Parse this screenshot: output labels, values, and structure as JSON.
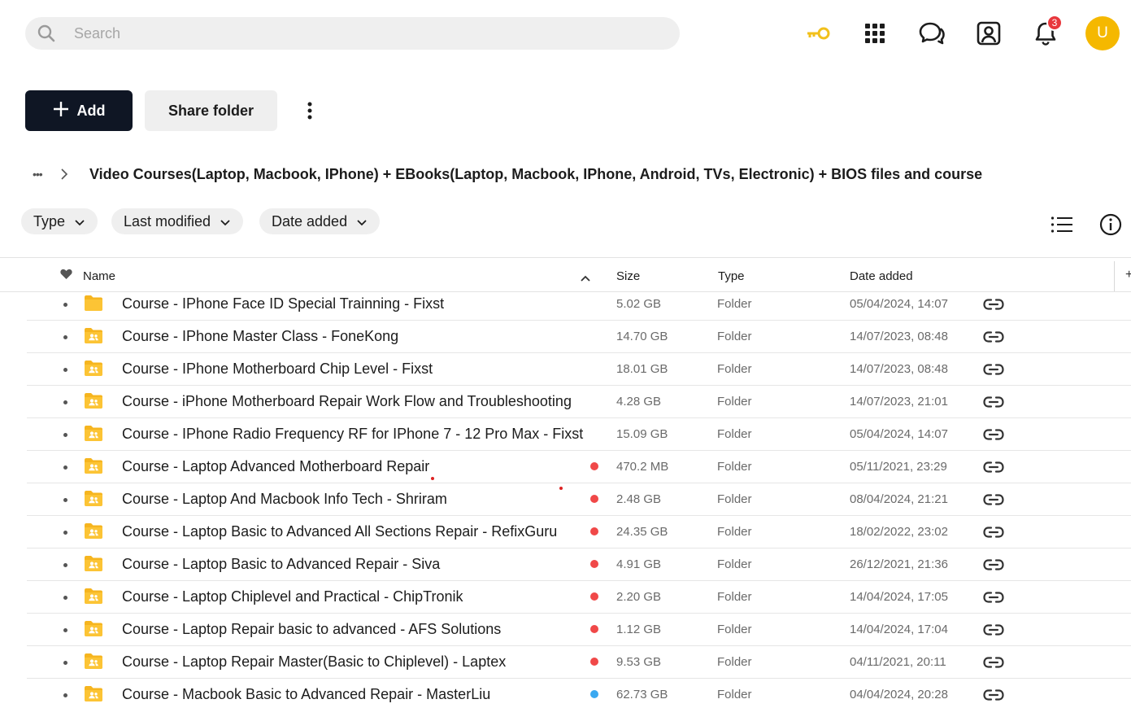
{
  "search": {
    "placeholder": "Search"
  },
  "header": {
    "notifications_count": "3",
    "avatar_initial": "U",
    "colors": {
      "key": "#f2c01b",
      "avatar": "#f5b800",
      "badge": "#e8373c"
    }
  },
  "actions": {
    "add_label": "Add",
    "share_label": "Share folder"
  },
  "breadcrumb": {
    "ellipsis": "•••",
    "current": "Video Courses(Laptop, Macbook, IPhone) + EBooks(Laptop, Macbook, IPhone, Android, TVs, Electronic) + BIOS files and course"
  },
  "filters": [
    "Type",
    "Last modified",
    "Date added"
  ],
  "table": {
    "headers": {
      "name": "Name",
      "size": "Size",
      "type": "Type",
      "date": "Date added"
    },
    "rows": [
      {
        "name": "Course - IPhone Face ID Special Trainning - Fixst",
        "size": "5.02 GB",
        "type": "Folder",
        "date": "05/04/2024, 14:07",
        "icon": "folder-icon",
        "status": null
      },
      {
        "name": "Course - IPhone Master Class - FoneKong",
        "size": "14.70 GB",
        "type": "Folder",
        "date": "14/07/2023, 08:48",
        "icon": "shared-folder-icon",
        "status": null
      },
      {
        "name": "Course - IPhone Motherboard Chip Level - Fixst",
        "size": "18.01 GB",
        "type": "Folder",
        "date": "14/07/2023, 08:48",
        "icon": "shared-folder-icon",
        "status": null
      },
      {
        "name": "Course - iPhone Motherboard Repair Work Flow and Troubleshooting",
        "size": "4.28 GB",
        "type": "Folder",
        "date": "14/07/2023, 21:01",
        "icon": "shared-folder-icon",
        "status": null
      },
      {
        "name": "Course - IPhone Radio Frequency RF for IPhone 7 - 12 Pro Max - Fixst",
        "size": "15.09 GB",
        "type": "Folder",
        "date": "05/04/2024, 14:07",
        "icon": "shared-folder-icon",
        "status": null
      },
      {
        "name": "Course - Laptop Advanced Motherboard Repair",
        "size": "470.2 MB",
        "type": "Folder",
        "date": "05/11/2021, 23:29",
        "icon": "shared-folder-icon",
        "status": "#f04848"
      },
      {
        "name": "Course - Laptop And Macbook Info Tech - Shriram",
        "size": "2.48 GB",
        "type": "Folder",
        "date": "08/04/2024, 21:21",
        "icon": "shared-folder-icon",
        "status": "#f04848"
      },
      {
        "name": "Course - Laptop Basic to Advanced All Sections Repair - RefixGuru",
        "size": "24.35 GB",
        "type": "Folder",
        "date": "18/02/2022, 23:02",
        "icon": "shared-folder-icon",
        "status": "#f04848"
      },
      {
        "name": "Course - Laptop Basic to Advanced Repair - Siva",
        "size": "4.91 GB",
        "type": "Folder",
        "date": "26/12/2021, 21:36",
        "icon": "shared-folder-icon",
        "status": "#f04848"
      },
      {
        "name": "Course - Laptop Chiplevel and Practical - ChipTronik",
        "size": "2.20 GB",
        "type": "Folder",
        "date": "14/04/2024, 17:05",
        "icon": "shared-folder-icon",
        "status": "#f04848"
      },
      {
        "name": "Course - Laptop Repair basic to advanced - AFS Solutions",
        "size": "1.12 GB",
        "type": "Folder",
        "date": "14/04/2024, 17:04",
        "icon": "shared-folder-icon",
        "status": "#f04848"
      },
      {
        "name": "Course - Laptop Repair Master(Basic to Chiplevel) - Laptex",
        "size": "9.53 GB",
        "type": "Folder",
        "date": "04/11/2021, 20:11",
        "icon": "shared-folder-icon",
        "status": "#f04848"
      },
      {
        "name": "Course - Macbook Basic to Advanced Repair - MasterLiu",
        "size": "62.73 GB",
        "type": "Folder",
        "date": "04/04/2024, 20:28",
        "icon": "shared-folder-icon",
        "status": "#3aa8f0"
      }
    ]
  }
}
